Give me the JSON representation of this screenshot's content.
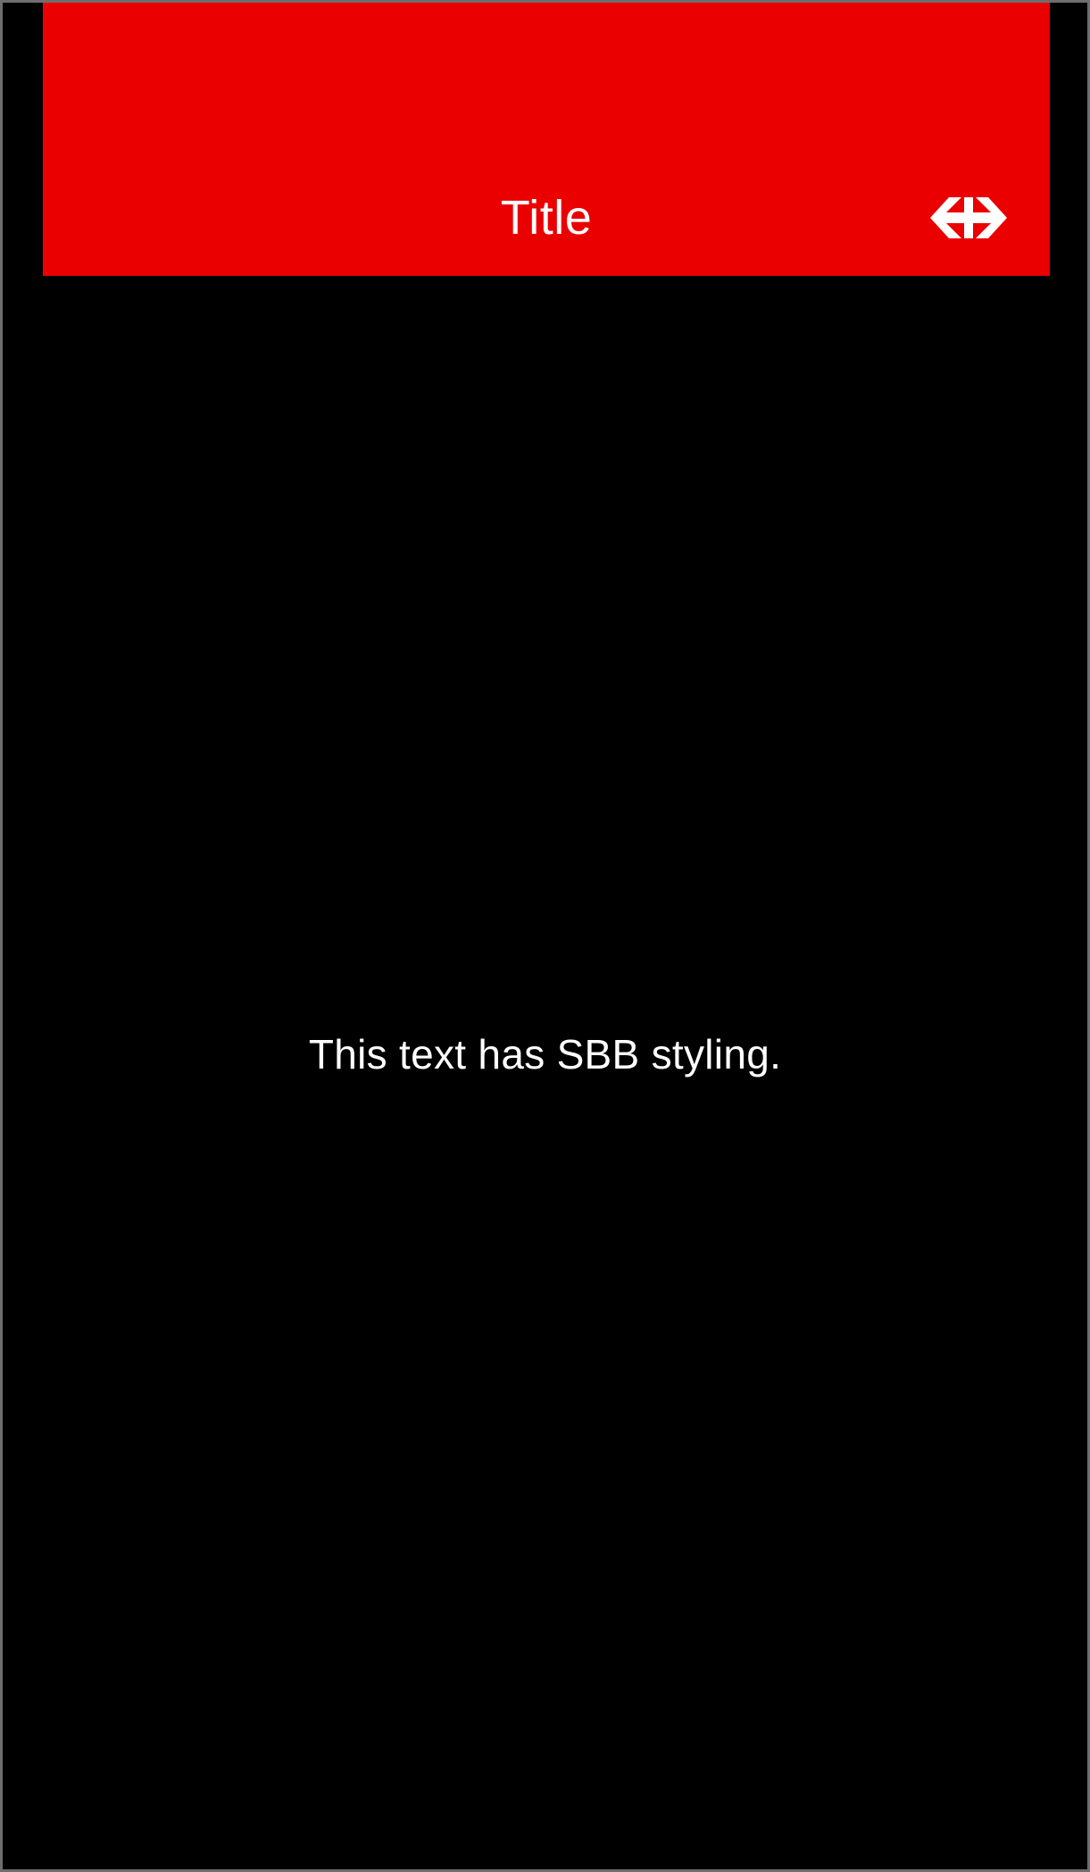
{
  "app_bar": {
    "title": "Title",
    "logo_icon": "sbb-logo-icon",
    "background_color": "#eb0000",
    "title_color": "#ffffff"
  },
  "main": {
    "text": "This text has SBB styling.",
    "background_color": "#000000",
    "text_color": "#ffffff"
  }
}
